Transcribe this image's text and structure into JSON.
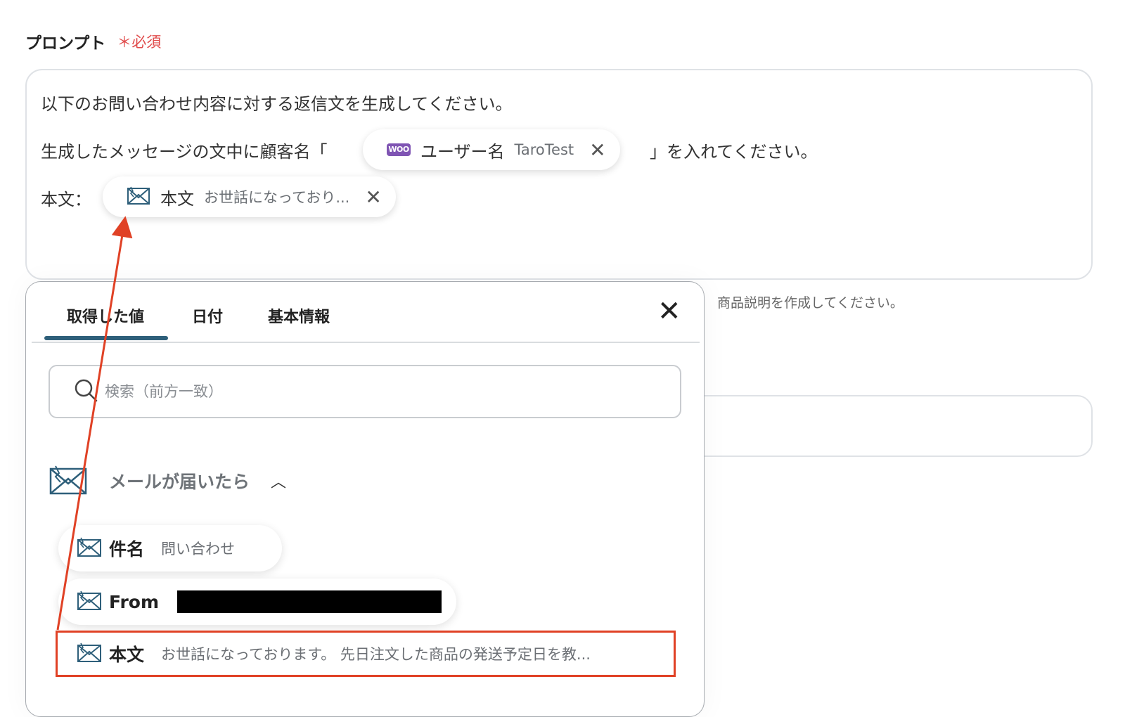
{
  "prompt": {
    "label": "プロンプト",
    "required": "＊必須",
    "line1": "以下のお問い合わせ内容に対する返信文を生成してください。",
    "line2_prefix": "生成したメッセージの文中に顧客名「",
    "line2_suffix": "」を入れてください。",
    "line3_prefix": "本文：",
    "username_chip": {
      "key": "ユーザー名",
      "value": "TaroTest",
      "icon": "woo-icon"
    },
    "body_chip": {
      "key": "本文",
      "value": "お世話になっており...",
      "icon": "mail-icon"
    },
    "remove_icon": "✕"
  },
  "helper_text": "商品説明を作成してください。",
  "woo_label": "WOO",
  "panel": {
    "tabs": [
      "取得した値",
      "日付",
      "基本情報"
    ],
    "close": "✕",
    "search": {
      "placeholder": "検索（前方一致）"
    },
    "section": {
      "title": "メールが届いたら",
      "chevron": "︿"
    },
    "items": [
      {
        "key": "件名",
        "value": "問い合わせ"
      },
      {
        "key": "From",
        "value": ""
      },
      {
        "key": "本文",
        "value": "お世話になっております。 先日注文した商品の発送予定日を教..."
      }
    ]
  },
  "colors": {
    "accent": "#2e5f7a",
    "required": "#e04b4b",
    "highlight": "#e04125",
    "woo": "#7f54b3"
  }
}
